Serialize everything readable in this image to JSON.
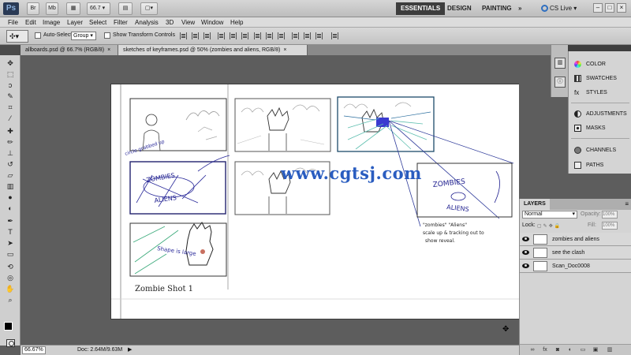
{
  "app": {
    "logo": "Ps",
    "zoom_value": "66.7",
    "workspaces": [
      "ESSENTIALS",
      "DESIGN",
      "PAINTING"
    ],
    "more_workspaces": "»",
    "cs_live": "CS Live",
    "window_controls": [
      "–",
      "□",
      "×"
    ]
  },
  "menu": {
    "items": [
      "File",
      "Edit",
      "Image",
      "Layer",
      "Select",
      "Filter",
      "Analysis",
      "3D",
      "View",
      "Window",
      "Help"
    ]
  },
  "options_bar": {
    "auto_select_label": "Auto-Select:",
    "auto_select_value": "Group",
    "show_transform_label": "Show Transform Controls"
  },
  "tabs": [
    {
      "label": "allboards.psd @ 66.7% (RGB/8)",
      "close": "×"
    },
    {
      "label": "sketches of keyframes.psd @ 50% (zombies and aliens, RGB/8)",
      "close": "×"
    }
  ],
  "canvas": {
    "watermark": "www.cgtsj.com",
    "sketch_texts": {
      "panel4_a": "ZOMBIES",
      "panel4_b": "ALIENS",
      "panel4_note": "circle grabbed up",
      "panel7_a": "Shape is large",
      "panel7_caption": "Zombie Shot 1",
      "panel8_a": "ZOMBIES",
      "panel8_b": "ALIENS",
      "panel8_note1": "\"zombies\" \"Aliens\"",
      "panel8_note2": "scale up & tracking out to",
      "panel8_note3": "show reveal."
    }
  },
  "status": {
    "zoom": "66.67%",
    "doc_size": "Doc: 2.64M/9.63M",
    "arrow": "▶"
  },
  "panels": {
    "items": [
      "COLOR",
      "SWATCHES",
      "STYLES",
      "ADJUSTMENTS",
      "MASKS",
      "CHANNELS",
      "PATHS"
    ]
  },
  "layers_panel": {
    "tab_label": "LAYERS",
    "blend_mode": "Normal",
    "opacity_label": "Opacity:",
    "opacity_value": "100%",
    "lock_label": "Lock:",
    "fill_label": "Fill:",
    "fill_value": "100%",
    "layers": [
      "zombies and aliens",
      "see the clash",
      "Scan_Doc0008"
    ],
    "footer_icons": [
      "link-icon",
      "fx-icon",
      "mask-icon",
      "adjustment-icon",
      "folder-icon",
      "new-layer-icon",
      "trash-icon"
    ]
  }
}
